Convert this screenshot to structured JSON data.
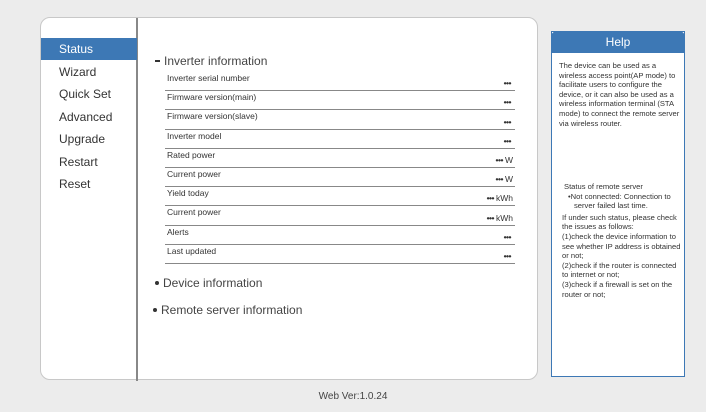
{
  "nav": {
    "items": [
      {
        "label": "Status",
        "active": true
      },
      {
        "label": "Wizard"
      },
      {
        "label": "Quick Set"
      },
      {
        "label": "Advanced"
      },
      {
        "label": "Upgrade"
      },
      {
        "label": "Restart"
      },
      {
        "label": "Reset"
      }
    ]
  },
  "inverter": {
    "title": "Inverter information",
    "rows": [
      {
        "label": "Inverter serial number",
        "value": "•••",
        "unit": ""
      },
      {
        "label": "Firmware version(main)",
        "value": "•••",
        "unit": ""
      },
      {
        "label": "Firmware version(slave)",
        "value": "•••",
        "unit": ""
      },
      {
        "label": "Inverter model",
        "value": "•••",
        "unit": ""
      },
      {
        "label": "Rated power",
        "value": "•••",
        "unit": "W"
      },
      {
        "label": "Current power",
        "value": "•••",
        "unit": "W"
      },
      {
        "label": "Yield today",
        "value": "•••",
        "unit": "kWh"
      },
      {
        "label": "Current power",
        "value": "•••",
        "unit": "kWh"
      },
      {
        "label": "Alerts",
        "value": "•••",
        "unit": ""
      },
      {
        "label": "Last updated",
        "value": "•••",
        "unit": ""
      }
    ]
  },
  "device": {
    "title": "Device information"
  },
  "remote": {
    "title": "Remote server information"
  },
  "help": {
    "title": "Help",
    "intro": "The device can be used as a wireless access point(AP mode) to facilitate users to configure the device, or it can also be used as a wireless information terminal (STA mode) to connect the remote server via wireless router.",
    "status_heading": "Status of remote server",
    "status_bullet": "Not connected: Connection to server failed last time.",
    "status_body": "If under such status, please check the issues as follows:",
    "checks": [
      "(1)check the device information to see whether IP address is obtained or not;",
      "(2)check if the router is connected to internet or not;",
      "(3)check if a firewall is set on the router or not;"
    ]
  },
  "footer": {
    "version": "Web Ver:1.0.24"
  }
}
